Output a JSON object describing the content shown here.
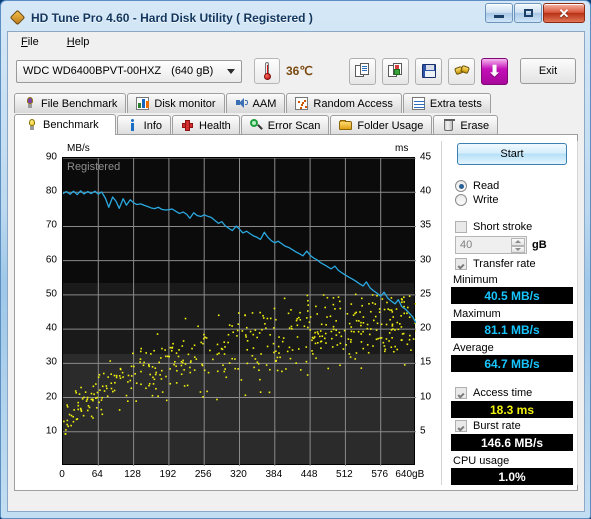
{
  "window": {
    "title": "HD Tune Pro 4.60 - Hard Disk Utility (  Registered )",
    "icon": "hdtune-app-icon",
    "minimize": "–",
    "maximize": "□",
    "close": "✕"
  },
  "menu": {
    "items": [
      {
        "label": "File",
        "accel": "F"
      },
      {
        "label": "Help",
        "accel": "H"
      }
    ]
  },
  "toolbar": {
    "drive": {
      "name": "WDC WD6400BPVT-00HXZ",
      "capacity": "(640 gB)"
    },
    "temperature": {
      "value": "36℃",
      "icon": "thermometer-icon"
    },
    "buttons": [
      {
        "name": "copy-icon",
        "label": ""
      },
      {
        "name": "copy-image-icon",
        "label": ""
      },
      {
        "name": "save-icon",
        "label": ""
      },
      {
        "name": "plug-icon",
        "label": ""
      },
      {
        "name": "download-icon",
        "label": ""
      }
    ],
    "exit_label": "Exit"
  },
  "tabs": {
    "row1": [
      {
        "label": "File Benchmark",
        "icon": "bulb-purple-icon"
      },
      {
        "label": "Disk monitor",
        "icon": "bar-chart-icon"
      },
      {
        "label": "AAM",
        "icon": "speaker-icon"
      },
      {
        "label": "Random Access",
        "icon": "scatter-icon"
      },
      {
        "label": "Extra tests",
        "icon": "grid-chart-icon"
      }
    ],
    "row2": [
      {
        "label": "Benchmark",
        "icon": "bulb-icon",
        "active": true
      },
      {
        "label": "Info",
        "icon": "info-icon",
        "active": false
      },
      {
        "label": "Health",
        "icon": "red-cross-icon",
        "active": false
      },
      {
        "label": "Error Scan",
        "icon": "magnifier-icon",
        "active": false
      },
      {
        "label": "Folder Usage",
        "icon": "folder-icon",
        "active": false
      },
      {
        "label": "Erase",
        "icon": "trash-icon",
        "active": false
      }
    ]
  },
  "chart_data": {
    "type": "line",
    "title": "",
    "watermark": "Registered",
    "xlabel": "",
    "ylabel": "MB/s",
    "y2label": "ms",
    "xlim": [
      0,
      640
    ],
    "ylim": [
      0,
      90
    ],
    "y2lim": [
      0,
      45
    ],
    "grid": true,
    "xticks": [
      0,
      64,
      128,
      192,
      256,
      320,
      384,
      448,
      512,
      576,
      640
    ],
    "xtick_labels": [
      "0",
      "64",
      "128",
      "192",
      "256",
      "320",
      "384",
      "448",
      "512",
      "576",
      "640gB"
    ],
    "yticks": [
      10,
      20,
      30,
      40,
      50,
      60,
      70,
      80,
      90
    ],
    "y2ticks": [
      5,
      10,
      15,
      20,
      25,
      30,
      35,
      40,
      45
    ],
    "series": [
      {
        "name": "Transfer rate",
        "type": "line",
        "color": "#2aa8e0",
        "axis": "left",
        "x": [
          0,
          6,
          13,
          19,
          26,
          32,
          38,
          45,
          51,
          58,
          64,
          70,
          77,
          83,
          90,
          96,
          102,
          109,
          115,
          122,
          128,
          134,
          141,
          147,
          154,
          160,
          166,
          173,
          179,
          186,
          192,
          198,
          205,
          211,
          218,
          224,
          230,
          237,
          243,
          250,
          256,
          262,
          269,
          275,
          282,
          288,
          294,
          301,
          307,
          314,
          320,
          326,
          333,
          339,
          346,
          352,
          358,
          365,
          371,
          378,
          384,
          390,
          397,
          403,
          410,
          416,
          422,
          429,
          435,
          442,
          448,
          454,
          461,
          467,
          474,
          480,
          486,
          493,
          499,
          506,
          512,
          518,
          525,
          531,
          538,
          544,
          550,
          557,
          563,
          570,
          576,
          582,
          589,
          595,
          602,
          608,
          614,
          621,
          627,
          634,
          640
        ],
        "y": [
          79.6,
          80.2,
          79.4,
          80.3,
          79.3,
          80.4,
          79.5,
          80.2,
          79.6,
          80.3,
          79.4,
          80.1,
          78.2,
          75.6,
          78.6,
          77.4,
          75.3,
          78.1,
          76.2,
          77.8,
          76.9,
          76.4,
          76.6,
          76.2,
          75.8,
          75.4,
          75.2,
          75.6,
          75.0,
          74.8,
          74.9,
          75.1,
          74.4,
          73.8,
          74.2,
          73.6,
          72.4,
          74.0,
          73.2,
          72.9,
          73.4,
          73.0,
          72.6,
          71.8,
          70.9,
          71.4,
          70.2,
          69.4,
          68.8,
          70.1,
          69.2,
          68.1,
          68.6,
          67.9,
          67.2,
          66.8,
          66.2,
          68.3,
          66.9,
          65.8,
          65.2,
          65.7,
          64.9,
          64.2,
          63.8,
          63.2,
          62.6,
          62.0,
          61.4,
          62.8,
          61.6,
          60.8,
          60.2,
          59.4,
          58.8,
          58.2,
          57.6,
          58.4,
          57.2,
          56.4,
          55.8,
          55.2,
          54.6,
          54.0,
          53.2,
          52.6,
          53.8,
          52.0,
          51.2,
          50.4,
          49.6,
          50.8,
          49.0,
          48.2,
          47.4,
          48.6,
          46.6,
          45.8,
          44.8,
          43.6,
          41.8
        ]
      },
      {
        "name": "Access time",
        "type": "scatter",
        "color": "#f2f20d",
        "axis": "right",
        "points_count": 480,
        "ms_range": [
          4.5,
          23.0
        ],
        "average_ms": 18.3
      }
    ]
  },
  "results": {
    "start_label": "Start",
    "mode": {
      "read": "Read",
      "write": "Write",
      "selected": "Read"
    },
    "short_stroke": {
      "label": "Short stroke",
      "checked": false,
      "value": "40",
      "unit": "gB"
    },
    "transfer_rate": {
      "label": "Transfer rate",
      "checked": true
    },
    "minimum": {
      "label": "Minimum",
      "value": "40.5 MB/s"
    },
    "maximum": {
      "label": "Maximum",
      "value": "81.1 MB/s"
    },
    "average": {
      "label": "Average",
      "value": "64.7 MB/s"
    },
    "access_time": {
      "label": "Access time",
      "checked": true,
      "value": "18.3 ms"
    },
    "burst_rate": {
      "label": "Burst rate",
      "checked": true,
      "value": "146.6 MB/s"
    },
    "cpu_usage": {
      "label": "CPU usage",
      "value": "1.0%"
    }
  }
}
